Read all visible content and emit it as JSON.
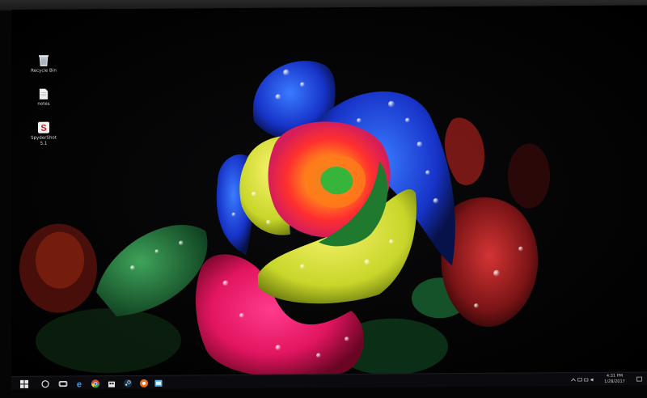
{
  "desktop": {
    "icons": [
      {
        "label": "Recycle Bin",
        "icon": "recycle-bin-icon"
      },
      {
        "label": "notes",
        "icon": "text-file-icon"
      },
      {
        "label": "SpyderShot",
        "sublabel": "5.1",
        "icon": "spydershot-app-icon"
      }
    ],
    "wallpaper": "rainbow-rose-with-water-droplets"
  },
  "taskbar": {
    "items": [
      {
        "name": "start-button",
        "icon": "windows-logo-icon"
      },
      {
        "name": "search-button",
        "icon": "search-icon"
      },
      {
        "name": "task-view-button",
        "icon": "task-view-icon"
      },
      {
        "name": "edge-button",
        "icon": "edge-icon"
      },
      {
        "name": "chrome-button",
        "icon": "chrome-icon"
      },
      {
        "name": "store-button",
        "icon": "store-icon"
      },
      {
        "name": "steam-button",
        "icon": "steam-icon"
      },
      {
        "name": "spyder-button",
        "icon": "spyder-icon"
      },
      {
        "name": "app-button",
        "icon": "app-icon"
      }
    ],
    "clock": {
      "time": "4:31 PM",
      "date": "1/28/2017"
    },
    "colors": {
      "bar": "#0b0b0f",
      "accent": "#3aa0ff"
    }
  }
}
